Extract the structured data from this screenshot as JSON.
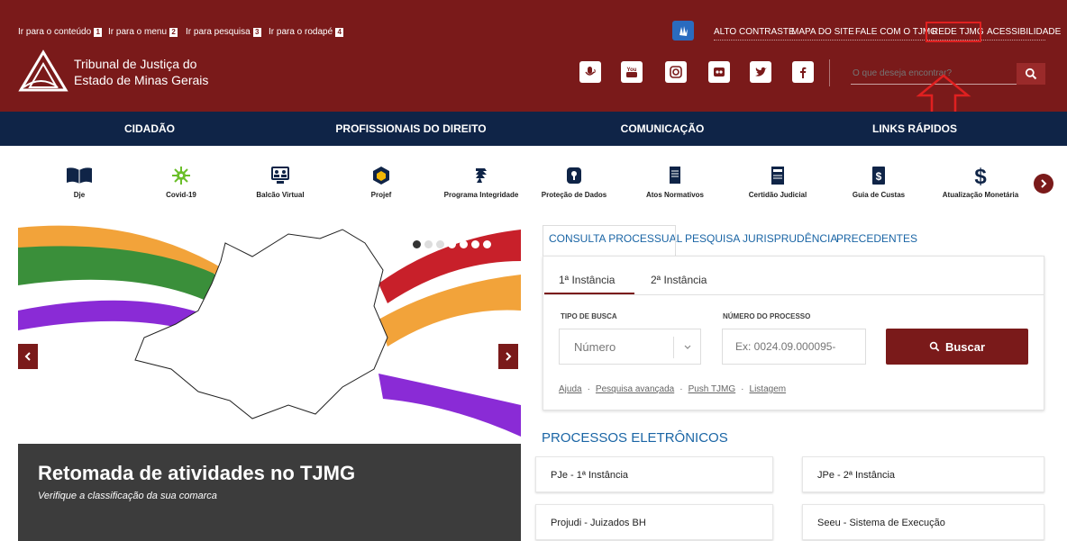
{
  "skip_links": [
    {
      "label": "Ir para o conteúdo",
      "key": "1"
    },
    {
      "label": "Ir para o menu",
      "key": "2"
    },
    {
      "label": "Ir para pesquisa",
      "key": "3"
    },
    {
      "label": "Ir para o rodapé",
      "key": "4"
    }
  ],
  "utility_links": [
    "ALTO CONTRASTE",
    "MAPA DO SITE",
    "FALE COM O TJMG",
    "REDE TJMG",
    "ACESSIBILIDADE"
  ],
  "brand": {
    "line1": "Tribunal de Justiça do",
    "line2": "Estado de Minas Gerais"
  },
  "social_icons": [
    "podcast-icon",
    "youtube-icon",
    "instagram-icon",
    "flickr-icon",
    "twitter-icon",
    "facebook-icon"
  ],
  "search": {
    "placeholder": "O que deseja encontrar?"
  },
  "nav": [
    "CIDADÃO",
    "PROFISSIONAIS DO DIREITO",
    "COMUNICAÇÃO",
    "LINKS RÁPIDOS"
  ],
  "quick_links": [
    {
      "label": "Dje",
      "icon": "book-icon"
    },
    {
      "label": "Covid-19",
      "icon": "virus-icon"
    },
    {
      "label": "Balcão Virtual",
      "icon": "video-call-icon"
    },
    {
      "label": "Projef",
      "icon": "hexagon-icon"
    },
    {
      "label": "Programa Integridade",
      "icon": "integrity-icon"
    },
    {
      "label": "Proteção de Dados",
      "icon": "lock-icon"
    },
    {
      "label": "Atos Normativos",
      "icon": "document-icon"
    },
    {
      "label": "Certidão Judicial",
      "icon": "certificate-icon"
    },
    {
      "label": "Guia de Custas",
      "icon": "dollar-doc-icon"
    },
    {
      "label": "Atualização Monetária",
      "icon": "dollar-icon"
    }
  ],
  "banner": {
    "title": "Retomada de atividades no TJMG",
    "subtitle": "Verifique a classificação da sua comarca",
    "slide_count": 7,
    "active_slide": 1
  },
  "tabs": [
    "CONSULTA PROCESSUAL",
    "PESQUISA JURISPRUDÊNCIA",
    "PRECEDENTES"
  ],
  "subtabs": [
    "1ª Instância",
    "2ª Instância"
  ],
  "form": {
    "tipo_label": "TIPO DE BUSCA",
    "tipo_value": "Número",
    "numero_label": "NÚMERO DO PROCESSO",
    "numero_placeholder": "Ex: 0024.09.000095-",
    "buscar": "Buscar"
  },
  "help_links": [
    "Ajuda",
    "Pesquisa avançada",
    "Push TJMG",
    "Listagem"
  ],
  "proc_title": "PROCESSOS ELETRÔNICOS",
  "proc_items": [
    "PJe - 1ª Instância",
    "JPe - 2ª Instância",
    "Projudi - Juizados BH",
    "Seeu - Sistema de Execução"
  ],
  "colors": {
    "header": "#7a1a1a",
    "nav": "#0f2447",
    "link": "#1a65a5",
    "highlight": "#e02020"
  }
}
